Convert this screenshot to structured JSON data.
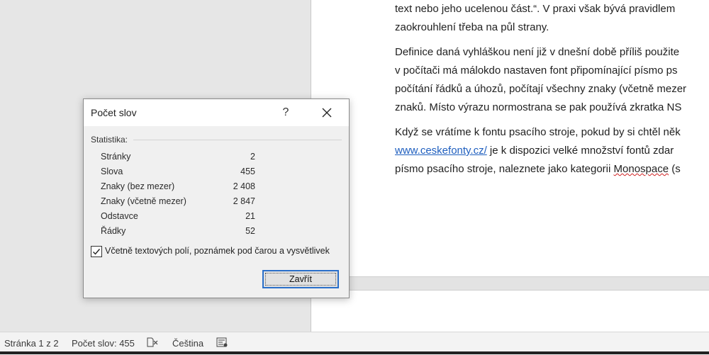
{
  "document": {
    "lines_p1": [
      "text nebo jeho ucelenou část.“.  V praxi však bývá pravidlem",
      "zaokrouhlení třeba na půl strany."
    ],
    "lines_p2": [
      "Definice daná vyhláškou není již v dnešní době příliš použite",
      "v počítači má málokdo nastaven font připomínající písmo ps",
      "počítání řádků a úhozů, počítají všechny znaky (včetně mezer",
      "znaků. Místo výrazu normostrana se pak používá zkratka NS"
    ],
    "p3_line1": "Když se vrátíme k fontu psacího stroje, pokud by si chtěl něk",
    "p3_line2_link": "www.ceskefonty.cz/",
    "p3_line2_rest": " je k dispozici velké množství fontů zdar",
    "p3_line3_start": "písmo psacího stroje, naleznete jako kategorii ",
    "p3_line3_word": "Monospace",
    "p3_line3_end": " (s"
  },
  "dialog": {
    "title": "Počet slov",
    "help": "?",
    "section_label": "Statistika:",
    "stats": [
      {
        "label": "Stránky",
        "value": "2"
      },
      {
        "label": "Slova",
        "value": "455"
      },
      {
        "label": "Znaky (bez mezer)",
        "value": "2 408"
      },
      {
        "label": "Znaky (včetně mezer)",
        "value": "2 847"
      },
      {
        "label": "Odstavce",
        "value": "21"
      },
      {
        "label": "Řádky",
        "value": "52"
      }
    ],
    "checkbox_label": "Včetně textových polí, poznámek pod čarou a vysvětlivek",
    "checkbox_checked": true,
    "close_button": "Zavřít"
  },
  "statusbar": {
    "page": "Stránka 1 z 2",
    "word_count": "Počet slov: 455",
    "proofing_icon": "proofing-icon",
    "language": "Čeština",
    "accessibility_icon": "accessibility-icon"
  }
}
